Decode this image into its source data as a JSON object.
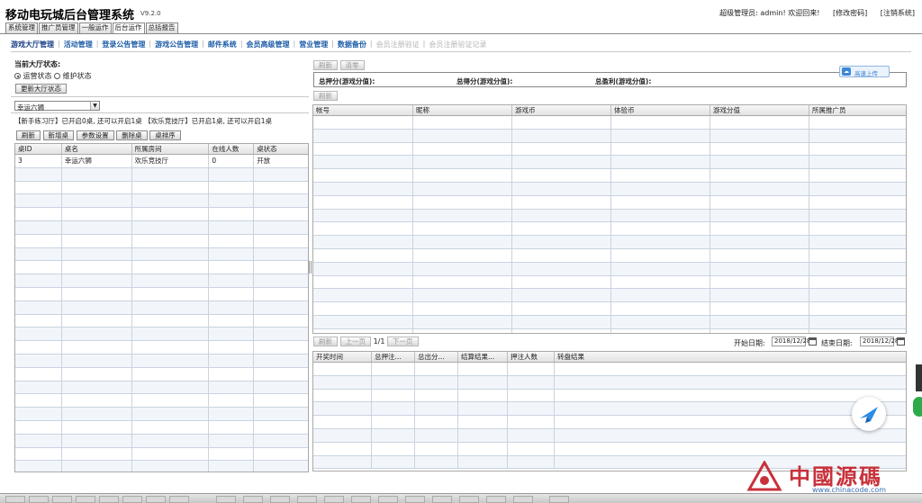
{
  "header": {
    "title": "移动电玩城后台管理系统",
    "version": "V9.2.0",
    "user_greeting": "超级管理员: admin! 欢迎回来!",
    "change_password": "[修改密码]",
    "logout": "[注销系统]"
  },
  "top_tabs": [
    "系统管理",
    "推广员管理",
    "一般运作",
    "后台运作",
    "总括报告"
  ],
  "sub_nav": {
    "items": [
      "游戏大厅管理",
      "活动管理",
      "登录公告管理",
      "游戏公告管理",
      "邮件系统",
      "会员高级管理",
      "营业管理",
      "数据备份",
      "会员注册验证",
      "会员注册验证记录"
    ],
    "active_index": 0,
    "disabled_from": 8
  },
  "left_panel": {
    "hall_status_label": "当前大厅状态:",
    "radio_operate": "运营状态",
    "radio_maintain": "维护状态",
    "update_button": "更新大厅状态",
    "game_select": "幸运六狮",
    "room_info": "【新手练习厅】已开启0桌, 还可以开启1桌  【欢乐竞技厅】已开启1桌, 还可以开启1桌",
    "buttons": [
      "刷新",
      "新增桌",
      "参数设置",
      "删除桌",
      "桌排序"
    ],
    "table_columns": [
      "桌ID",
      "桌名",
      "所属房间",
      "在线人数",
      "桌状态"
    ],
    "table_rows": [
      [
        "3",
        "幸运六狮",
        "欢乐竞技厅",
        "0",
        "开放"
      ]
    ]
  },
  "right_top": {
    "buttons": [
      "刷新",
      "清零"
    ],
    "summary": [
      "总押分(游戏分值):",
      "总得分(游戏分值):",
      "总盈利(游戏分值):"
    ],
    "upload_badge": "高速上传",
    "refresh": "刷新",
    "table_columns": [
      "帐号",
      "昵称",
      "游戏币",
      "体验币",
      "游戏分值",
      "所属推广员"
    ]
  },
  "right_bottom": {
    "refresh": "刷新",
    "prev": "上一页",
    "page": "1/1",
    "next": "下一页",
    "start_label": "开始日期:",
    "start_date": "2018/12/28",
    "end_label": "结束日期:",
    "end_date": "2018/12/28",
    "table_columns": [
      "开奖时间",
      "总押注...",
      "总出分...",
      "结算结果...",
      "押注人数",
      "转盘结果"
    ]
  },
  "watermark": {
    "text": "中國源碼",
    "url": "www.chinacode.com"
  },
  "colors": {
    "nav_blue": "#1f5ea8",
    "grid_line": "#c9d3e0",
    "row_alt": "#f2f6fb"
  }
}
